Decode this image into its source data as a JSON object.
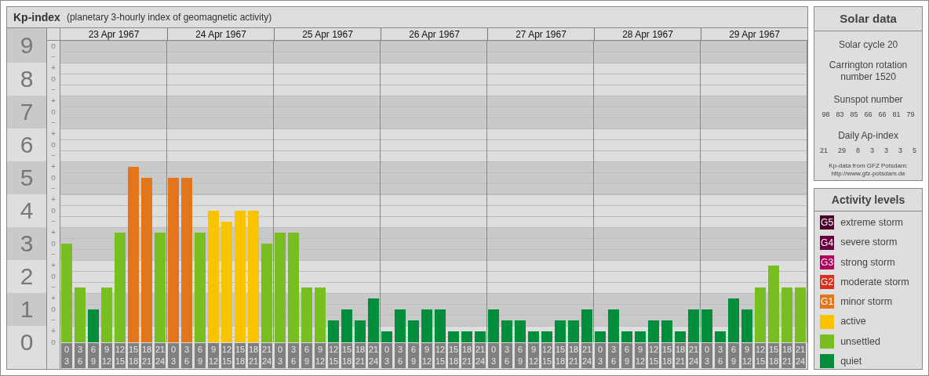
{
  "header": {
    "title": "Kp-index",
    "subtitle": "(planetary 3-hourly index of geomagnetic activity)"
  },
  "minor_marks": [
    "o",
    "−",
    "+",
    "o",
    "−",
    "+",
    "o",
    "−",
    "+",
    "o",
    "−",
    "+",
    "o",
    "−",
    "+",
    "o",
    "−",
    "+",
    "o",
    "−",
    "+",
    "o",
    "−",
    "+",
    "o",
    "−",
    "+",
    "o"
  ],
  "days": [
    "23 Apr 1967",
    "24 Apr 1967",
    "25 Apr 1967",
    "26 Apr 1967",
    "27 Apr 1967",
    "28 Apr 1967",
    "29 Apr 1967"
  ],
  "chart_data": {
    "type": "bar",
    "ylim": [
      0,
      9
    ],
    "grid": true,
    "yticks": [
      9,
      8,
      7,
      6,
      5,
      4,
      3,
      2,
      1,
      0
    ],
    "categories": [
      "0 3",
      "3 6",
      "6 9",
      "9 12",
      "12 15",
      "15 18",
      "18 21",
      "21 24",
      "0 3",
      "3 6",
      "6 9",
      "9 12",
      "12 15",
      "15 18",
      "18 21",
      "21 24",
      "0 3",
      "3 6",
      "6 9",
      "9 12",
      "12 15",
      "15 18",
      "18 21",
      "21 24",
      "0 3",
      "3 6",
      "6 9",
      "9 12",
      "12 15",
      "15 18",
      "18 21",
      "21 24",
      "0 3",
      "3 6",
      "6 9",
      "9 12",
      "12 15",
      "15 18",
      "18 21",
      "21 24",
      "0 3",
      "3 6",
      "6 9",
      "9 12",
      "12 15",
      "15 18",
      "18 21",
      "21 24",
      "0 3",
      "3 6",
      "6 9",
      "9 12",
      "12 15",
      "15 18",
      "18 21",
      "21 24"
    ],
    "values": [
      3,
      1.67,
      1,
      1.67,
      3.33,
      5.33,
      5,
      3.33,
      5,
      5,
      3.33,
      4,
      3.67,
      4,
      4,
      3,
      3.33,
      3.33,
      1.67,
      1.67,
      0.67,
      1,
      0.67,
      1.33,
      0.33,
      1,
      0.67,
      1,
      1,
      0.33,
      0.33,
      0.33,
      1,
      0.67,
      0.67,
      0.33,
      0.33,
      0.67,
      0.67,
      1,
      0.33,
      1,
      0.33,
      0.33,
      0.67,
      0.67,
      0.33,
      1,
      1,
      0.33,
      1.33,
      1,
      1.67,
      2.33,
      1.67,
      1.67
    ]
  },
  "solar_data": {
    "title": "Solar data",
    "cycle": "Solar cycle 20",
    "rotation": "Carrington rotation number 1520",
    "sunspot_label": "Sunspot number",
    "sunspots": [
      "98",
      "83",
      "85",
      "66",
      "66",
      "81",
      "79"
    ],
    "ap_label": "Daily Ap-index",
    "ap": [
      "21",
      "29",
      "8",
      "3",
      "3",
      "3",
      "5"
    ],
    "source": "Kp-data from GFZ Potsdam:",
    "source_url": "http://www.gfz-potsdam.de"
  },
  "activity_levels": {
    "title": "Activity levels",
    "items": [
      {
        "badge": "G5",
        "label": "extreme storm",
        "color": "#4a0028"
      },
      {
        "badge": "G4",
        "label": "severe storm",
        "color": "#6b0040"
      },
      {
        "badge": "G3",
        "label": "strong storm",
        "color": "#b0005c"
      },
      {
        "badge": "G2",
        "label": "moderate storm",
        "color": "#d8301c"
      },
      {
        "badge": "G1",
        "label": "minor storm",
        "color": "#e3761a"
      },
      {
        "label": "active",
        "color": "#f9c300"
      },
      {
        "label": "unsettled",
        "color": "#78be21"
      },
      {
        "label": "quiet",
        "color": "#008e3c"
      }
    ]
  }
}
